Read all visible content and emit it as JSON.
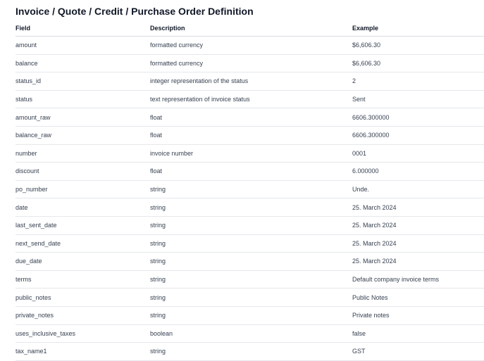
{
  "page": {
    "title": "Invoice / Quote / Credit / Purchase Order Definition"
  },
  "table": {
    "headers": [
      "Field",
      "Description",
      "Example"
    ],
    "rows": [
      [
        "amount",
        "formatted currency",
        "$6,606.30"
      ],
      [
        "balance",
        "formatted currency",
        "$6,606.30"
      ],
      [
        "status_id",
        "integer representation of the status",
        "2"
      ],
      [
        "status",
        "text representation of invoice status",
        "Sent"
      ],
      [
        "amount_raw",
        "float",
        "6606.300000"
      ],
      [
        "balance_raw",
        "float",
        "6606.300000"
      ],
      [
        "number",
        "invoice number",
        "0001"
      ],
      [
        "discount",
        "float",
        "6.000000"
      ],
      [
        "po_number",
        "string",
        "Unde."
      ],
      [
        "date",
        "string",
        "25. March 2024"
      ],
      [
        "last_sent_date",
        "string",
        "25. March 2024"
      ],
      [
        "next_send_date",
        "string",
        "25. March 2024"
      ],
      [
        "due_date",
        "string",
        "25. March 2024"
      ],
      [
        "terms",
        "string",
        "Default company invoice terms"
      ],
      [
        "public_notes",
        "string",
        "Public Notes"
      ],
      [
        "private_notes",
        "string",
        "Private notes"
      ],
      [
        "uses_inclusive_taxes",
        "boolean",
        "false"
      ],
      [
        "tax_name1",
        "string",
        "GST"
      ]
    ]
  }
}
